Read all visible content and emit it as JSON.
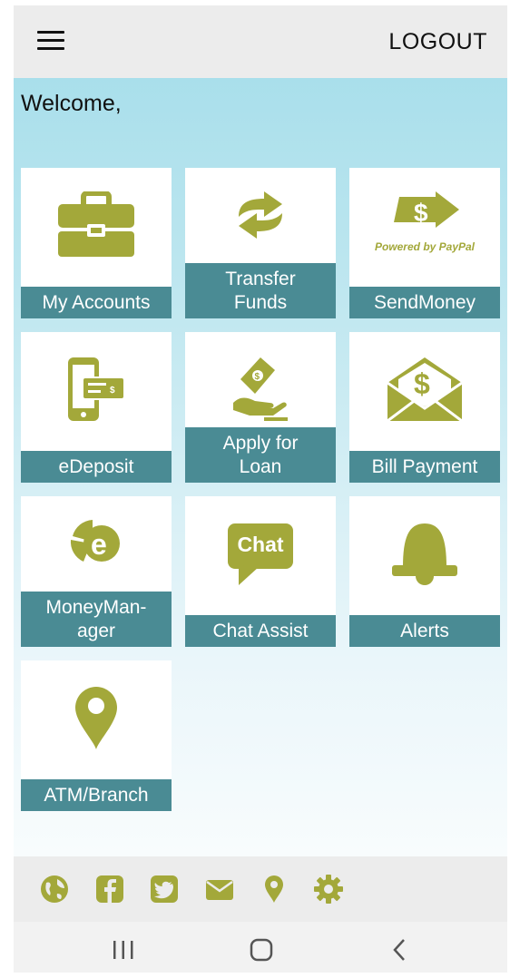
{
  "header": {
    "menu_icon": "hamburger-icon",
    "logout_label": "LOGOUT"
  },
  "welcome_text": "Welcome,",
  "tiles": [
    {
      "label": "My Accounts",
      "icon": "briefcase-icon"
    },
    {
      "label": "Transfer Funds",
      "icon": "transfer-arrows-icon"
    },
    {
      "label": "SendMoney",
      "icon": "paypal-send-money-icon",
      "logo_text": "Powered by PayPal"
    },
    {
      "label": "eDeposit",
      "icon": "mobile-check-deposit-icon"
    },
    {
      "label": "Apply for Loan",
      "icon": "hand-money-icon"
    },
    {
      "label": "Bill Payment",
      "icon": "envelope-dollar-icon"
    },
    {
      "label": "MoneyMan-ager",
      "icon": "money-manager-pie-icon"
    },
    {
      "label": "Chat Assist",
      "icon": "chat-bubble-icon",
      "icon_text": "Chat"
    },
    {
      "label": "Alerts",
      "icon": "bell-icon"
    },
    {
      "label": "ATM/Branch",
      "icon": "map-pin-icon"
    }
  ],
  "footer_icons": [
    "globe-icon",
    "facebook-icon",
    "twitter-icon",
    "mail-icon",
    "location-icon",
    "gear-icon"
  ],
  "system_nav": [
    "recent-apps-icon",
    "home-icon",
    "back-icon"
  ],
  "colors": {
    "accent_green": "#a3a83a",
    "label_teal": "#4a8b94",
    "bg_top": "#a9dfeb",
    "bar_gray": "#ececec"
  }
}
